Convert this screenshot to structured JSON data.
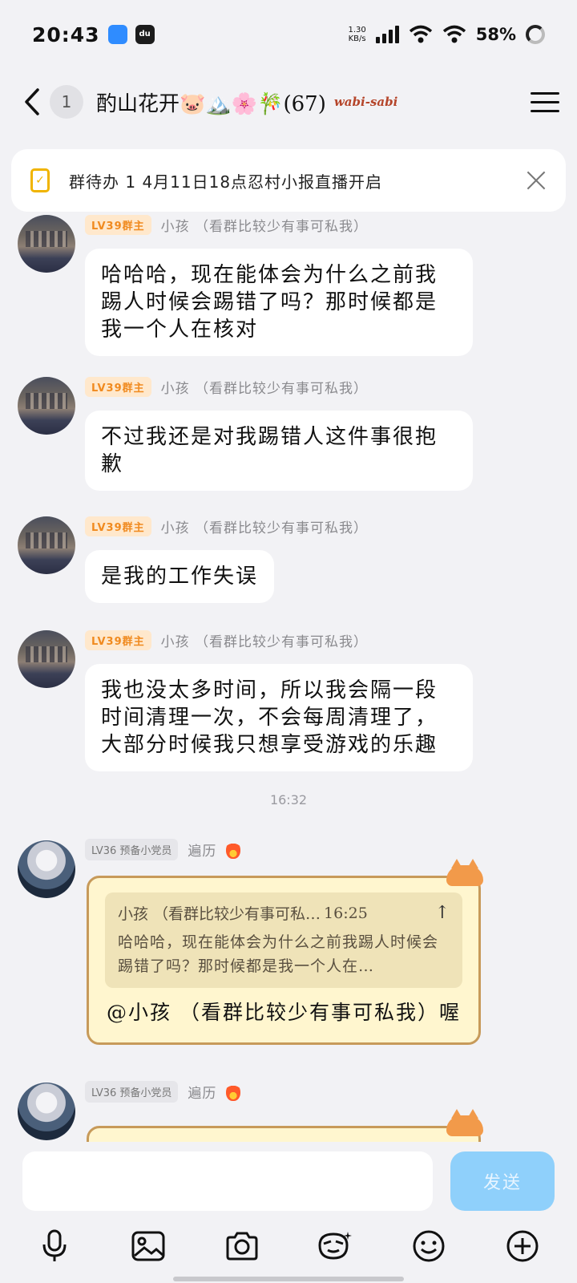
{
  "status_bar": {
    "time": "20:43",
    "app_icon_2": "du",
    "net_speed_value": "1.30",
    "net_speed_unit": "KB/s",
    "battery": "58%"
  },
  "header": {
    "unread_count": "1",
    "title": "酌山花开🐷🏔️🌸🎋(67)",
    "tag": "wabi-sabi"
  },
  "todo": {
    "text": "群待办 1 4月11日18点忍村小报直播开启"
  },
  "messages": [
    {
      "badge": "LV39群主",
      "nick": "小孩 （看群比较少有事可私我）",
      "text": "哈哈哈，现在能体会为什么之前我踢人时候会踢错了吗？那时候都是我一个人在核对"
    },
    {
      "badge": "LV39群主",
      "nick": "小孩 （看群比较少有事可私我）",
      "text": "不过我还是对我踢错人这件事很抱歉"
    },
    {
      "badge": "LV39群主",
      "nick": "小孩 （看群比较少有事可私我）",
      "text": "是我的工作失误"
    },
    {
      "badge": "LV39群主",
      "nick": "小孩 （看群比较少有事可私我）",
      "text": "我也没太多时间，所以我会隔一段时间清理一次，不会每周清理了，大部分时候我只想享受游戏的乐趣"
    }
  ],
  "time_divider": "16:32",
  "reply_messages": [
    {
      "badge": "LV36 预备小党员",
      "nick": "遍历",
      "quote_name": "小孩 （看群比较少有事可私…",
      "quote_time": "16:25",
      "quote_text": "哈哈哈，现在能体会为什么之前我踢人时候会踢错了吗？那时候都是我一个人在…",
      "text": "@小孩 （看群比较少有事可私我）喔"
    },
    {
      "badge": "LV36 预备小党员",
      "nick": "遍历"
    }
  ],
  "input": {
    "placeholder": "",
    "send_label": "发送"
  },
  "toolbar": [
    "mic-icon",
    "image-icon",
    "camera-icon",
    "sticker-icon",
    "emoji-icon",
    "plus-icon"
  ],
  "colors": {
    "background": "#f2f2f5",
    "owner_badge": "#f08a1f",
    "send_button": "#8fd0fb",
    "todo_icon": "#f0b400"
  }
}
